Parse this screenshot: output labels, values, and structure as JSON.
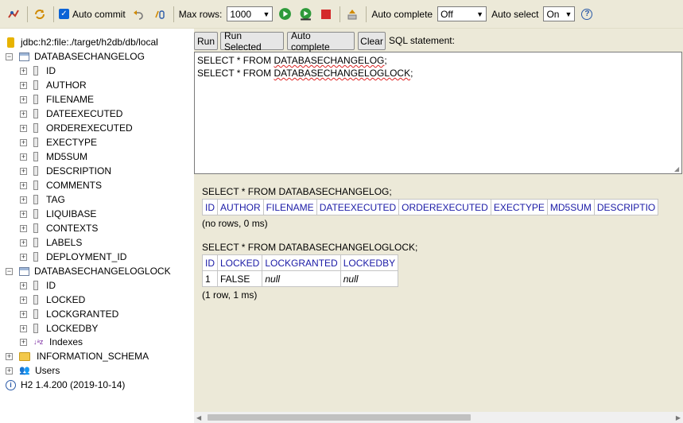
{
  "toolbar": {
    "auto_commit_label": "Auto commit",
    "max_rows_label": "Max rows:",
    "max_rows_value": "1000",
    "auto_complete_label": "Auto complete",
    "auto_complete_value": "Off",
    "auto_select_label": "Auto select",
    "auto_select_value": "On",
    "help_glyph": "?"
  },
  "tree": {
    "connection": "jdbc:h2:file:./target/h2db/db/local",
    "table1": {
      "name": "DATABASECHANGELOG",
      "columns": [
        "ID",
        "AUTHOR",
        "FILENAME",
        "DATEEXECUTED",
        "ORDEREXECUTED",
        "EXECTYPE",
        "MD5SUM",
        "DESCRIPTION",
        "COMMENTS",
        "TAG",
        "LIQUIBASE",
        "CONTEXTS",
        "LABELS",
        "DEPLOYMENT_ID"
      ]
    },
    "table2": {
      "name": "DATABASECHANGELOGLOCK",
      "columns": [
        "ID",
        "LOCKED",
        "LOCKGRANTED",
        "LOCKEDBY"
      ],
      "indexes_label": "Indexes"
    },
    "information_schema": "INFORMATION_SCHEMA",
    "users": "Users",
    "version": "H2 1.4.200 (2019-10-14)"
  },
  "buttons": {
    "run": "Run",
    "run_selected": "Run Selected",
    "auto_complete": "Auto complete",
    "clear": "Clear"
  },
  "sql_label": "SQL statement:",
  "sql_editor": {
    "line1_prefix": "SELECT * FROM ",
    "line1_table": "DATABASECHANGELOG",
    "line1_suffix": ";",
    "line2_prefix": "SELECT * FROM ",
    "line2_table": "DATABASECHANGELOGLOCK",
    "line2_suffix": ";"
  },
  "results": [
    {
      "query": "SELECT * FROM DATABASECHANGELOG;",
      "columns": [
        "ID",
        "AUTHOR",
        "FILENAME",
        "DATEEXECUTED",
        "ORDEREXECUTED",
        "EXECTYPE",
        "MD5SUM",
        "DESCRIPTIO"
      ],
      "rows": [],
      "status": "(no rows, 0 ms)"
    },
    {
      "query": "SELECT * FROM DATABASECHANGELOGLOCK;",
      "columns": [
        "ID",
        "LOCKED",
        "LOCKGRANTED",
        "LOCKEDBY"
      ],
      "rows": [
        [
          "1",
          "FALSE",
          "null",
          "null"
        ]
      ],
      "status": "(1 row, 1 ms)"
    }
  ]
}
